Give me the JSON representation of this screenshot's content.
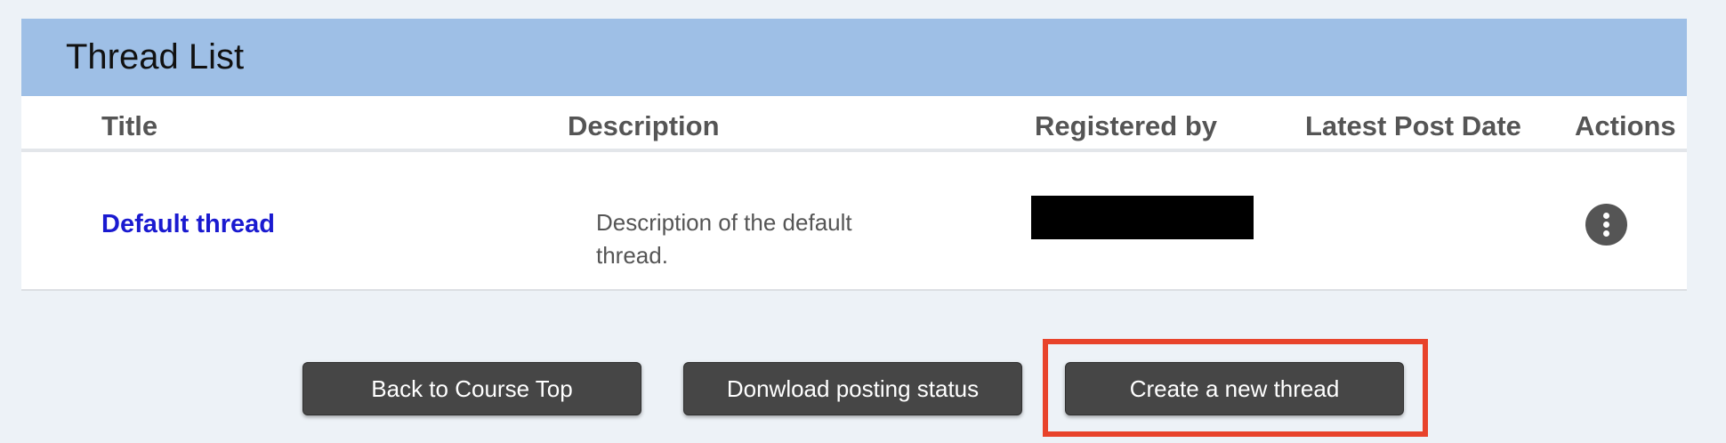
{
  "panel": {
    "title": "Thread List"
  },
  "table": {
    "columns": [
      "Title",
      "Description",
      "Registered by",
      "Latest Post Date",
      "Actions"
    ],
    "rows": [
      {
        "title": "Default thread",
        "description": "Description of the default thread.",
        "registered_by": "",
        "latest_post_date": "",
        "actions_icon": "more-vertical-icon"
      }
    ]
  },
  "buttons": {
    "back_label": "Back to Course Top",
    "download_label": "Donwload posting status",
    "create_label": "Create a new thread"
  },
  "colors": {
    "header_bg": "#9ebfe6",
    "link": "#1a1ad0",
    "button_bg": "#464646",
    "highlight": "#e8432b",
    "page_bg": "#edf2f7"
  }
}
